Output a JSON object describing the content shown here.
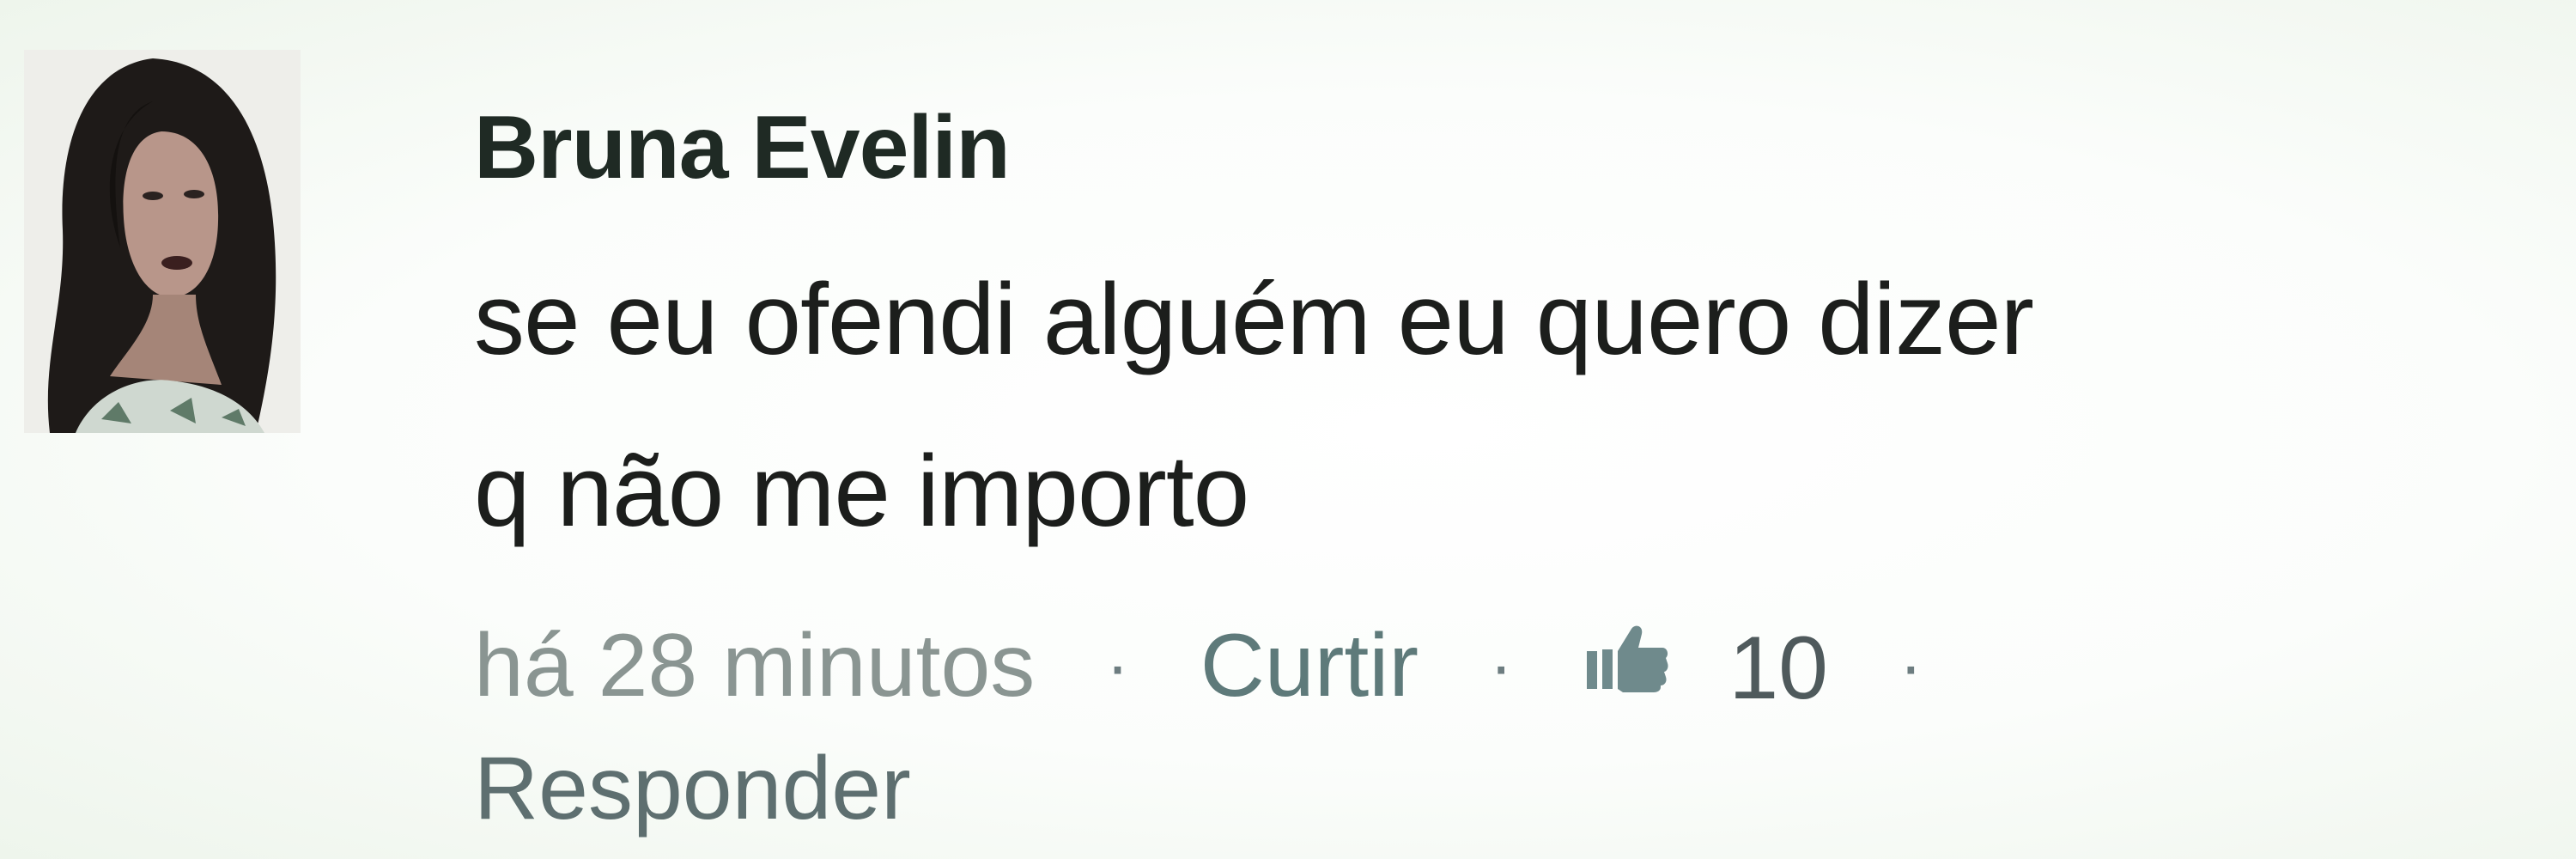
{
  "comment": {
    "author": "Bruna Evelin",
    "text_line1": "se eu ofendi alguém eu quero dizer",
    "text_line2": "q não me importo",
    "timestamp": "há 28 minutos",
    "separator": "·",
    "like_label": "Curtir",
    "like_count": "10",
    "reply_label": "Responder",
    "like_icon": "thumbs-up-icon"
  }
}
